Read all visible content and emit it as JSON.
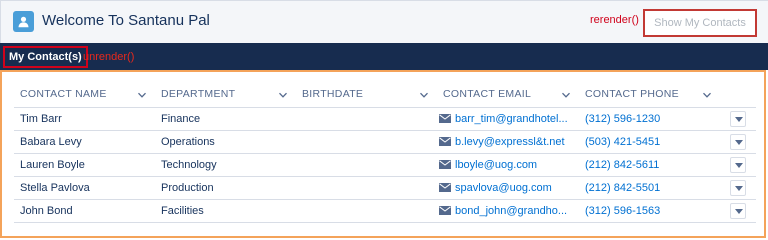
{
  "header": {
    "title": "Welcome To Santanu Pal",
    "rerender_annotation": "rerender()",
    "show_button_label": "Show My Contacts"
  },
  "nav": {
    "tab_label": "My Contact(s)",
    "unrender_annotation": "unrender()"
  },
  "table": {
    "columns": [
      "CONTACT NAME",
      "DEPARTMENT",
      "BIRTHDATE",
      "CONTACT EMAIL",
      "CONTACT PHONE"
    ],
    "rows": [
      {
        "name": "Tim Barr",
        "department": "Finance",
        "birthdate": "",
        "email": "barr_tim@grandhotel...",
        "phone": "(312) 596-1230"
      },
      {
        "name": "Babara Levy",
        "department": "Operations",
        "birthdate": "",
        "email": "b.levy@expressl&t.net",
        "phone": "(503) 421-5451"
      },
      {
        "name": "Lauren Boyle",
        "department": "Technology",
        "birthdate": "",
        "email": "lboyle@uog.com",
        "phone": "(212) 842-5611"
      },
      {
        "name": "Stella Pavlova",
        "department": "Production",
        "birthdate": "",
        "email": "spavlova@uog.com",
        "phone": "(212) 842-5501"
      },
      {
        "name": "John Bond",
        "department": "Facilities",
        "birthdate": "",
        "email": "bond_john@grandho...",
        "phone": "(312) 596-1563"
      }
    ]
  },
  "icons": {
    "app": "contact-card-icon",
    "sort": "chevron-down-icon",
    "email": "envelope-icon",
    "row_action": "dropdown-arrow-icon"
  },
  "colors": {
    "navbar": "#172c4f",
    "annotation_red": "#d0021b",
    "panel_border": "#f4a35a",
    "link": "#0070d2",
    "app_icon": "#4a9ed8"
  }
}
